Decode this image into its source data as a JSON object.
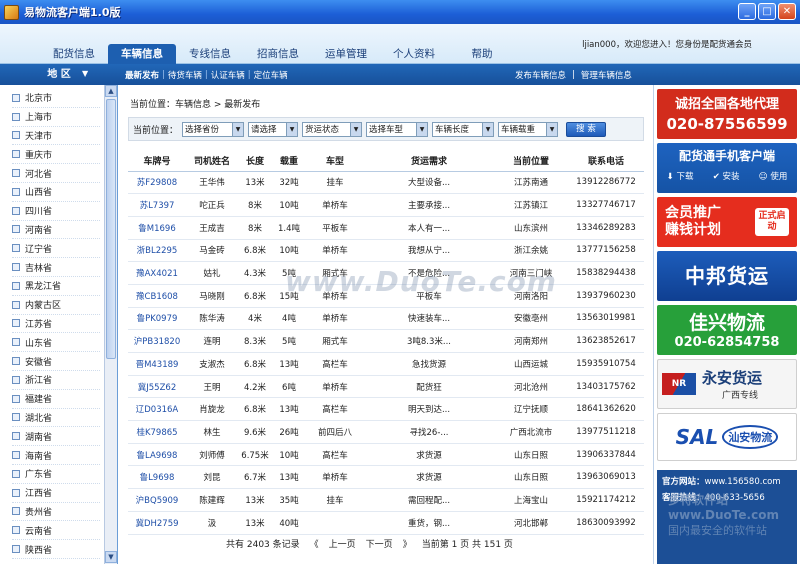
{
  "window": {
    "title": "易物流客户端1.0版",
    "min": "_",
    "max": "□",
    "close": "✕"
  },
  "header": {
    "tabs": [
      "配货信息",
      "车辆信息",
      "专线信息",
      "招商信息",
      "运单管理",
      "个人资料",
      "帮助"
    ],
    "active_tab": "车辆信息",
    "welcome": "ljian000，欢迎您进入！您身份是配货通会员"
  },
  "subnav": {
    "region_label": "地 区",
    "links": [
      "最新发布",
      "待货车辆",
      "认证车辆",
      "定位车辆"
    ],
    "right_links": [
      "发布车辆信息",
      "管理车辆信息"
    ]
  },
  "regions": [
    "北京市",
    "上海市",
    "天津市",
    "重庆市",
    "河北省",
    "山西省",
    "四川省",
    "河南省",
    "辽宁省",
    "吉林省",
    "黑龙江省",
    "内蒙古区",
    "江苏省",
    "山东省",
    "安徽省",
    "浙江省",
    "福建省",
    "湖北省",
    "湖南省",
    "海南省",
    "广东省",
    "江西省",
    "贵州省",
    "云南省",
    "陕西省"
  ],
  "breadcrumb": "当前位置：车辆信息 > 最新发布",
  "filters": {
    "label": "当前位置：",
    "selects": [
      "选择省份",
      "请选择",
      "货运状态",
      "选择车型",
      "车辆长度",
      "车辆载重"
    ],
    "search_btn": "搜 索"
  },
  "table": {
    "headers": [
      "车牌号",
      "司机姓名",
      "长度",
      "载重",
      "车型",
      "货运需求",
      "当前位置",
      "联系电话"
    ],
    "rows": [
      [
        "苏F29808",
        "王华伟",
        "13米",
        "32吨",
        "挂车",
        "大型设备...",
        "江苏南通",
        "13912286772"
      ],
      [
        "苏L7397",
        "咜正兵",
        "8米",
        "10吨",
        "单桥车",
        "主要承接...",
        "江苏镇江",
        "13327746717"
      ],
      [
        "鲁M1696",
        "王成吉",
        "8米",
        "1.4吨",
        "平板车",
        "本人有一...",
        "山东滨州",
        "13346289283"
      ],
      [
        "浙BL2295",
        "马金砖",
        "6.8米",
        "10吨",
        "单桥车",
        "我想从宁...",
        "浙江余姚",
        "13777156258"
      ],
      [
        "豫AX4021",
        "姑礼",
        "4.3米",
        "5吨",
        "厢式车",
        "不是危险...",
        "河南三门峡",
        "15838294438"
      ],
      [
        "豫CB1608",
        "马晓刚",
        "6.8米",
        "15吨",
        "单桥车",
        "平板车",
        "河南洛阳",
        "13937960230"
      ],
      [
        "鲁PK0979",
        "陈华涛",
        "4米",
        "4吨",
        "单桥车",
        "快速装车...",
        "安徽亳州",
        "13563019981"
      ],
      [
        "沪PB31820",
        "连明",
        "8.3米",
        "5吨",
        "厢式车",
        "3吨8.3米...",
        "河南郑州",
        "13623852617"
      ],
      [
        "晋M43189",
        "支淑杰",
        "6.8米",
        "13吨",
        "高栏车",
        "急找货源",
        "山西运城",
        "15935910754"
      ],
      [
        "冀J55Z62",
        "王明",
        "4.2米",
        "6吨",
        "单桥车",
        "配货狂",
        "河北沧州",
        "13403175762"
      ],
      [
        "辽D0316A",
        "肖旋龙",
        "6.8米",
        "13吨",
        "高栏车",
        "明天到达...",
        "辽宁抚顺",
        "18641362620"
      ],
      [
        "桂K79865",
        "林生",
        "9.6米",
        "26吨",
        "前四后八",
        "寻找26-...",
        "广西北流市",
        "13977511218"
      ],
      [
        "鲁LA9698",
        "刘师傅",
        "6.75米",
        "10吨",
        "高栏车",
        "求货源",
        "山东日照",
        "13906337844"
      ],
      [
        "鲁L9698",
        "刘昆",
        "6.7米",
        "13吨",
        "单桥车",
        "求货源",
        "山东日照",
        "13963069013"
      ],
      [
        "沪BQ5909",
        "陈建辉",
        "13米",
        "35吨",
        "挂车",
        "需回程配...",
        "上海宝山",
        "15921174212"
      ],
      [
        "冀DH2759",
        "汲",
        "13米",
        "40吨",
        "",
        "重货，钢...",
        "河北邯郸",
        "18630093992"
      ]
    ]
  },
  "pager": {
    "total": "共有 2403 条记录",
    "first": "《",
    "prev": "上一页",
    "next": "下一页",
    "last": "》",
    "current": "当前第 1 页 共 151 页"
  },
  "ads": {
    "ad1": [
      "诚招全国各地代理",
      "020-87556599"
    ],
    "ad2": {
      "title": "配货通手机客户端",
      "items": [
        "下载",
        "安装",
        "使用"
      ]
    },
    "ad3": {
      "text": [
        "会员推广",
        "赚钱计划"
      ],
      "tag": "正式启动"
    },
    "ad4": "中邦货运",
    "ad5": [
      "佳兴物流",
      "020-62854758"
    ],
    "ad6": {
      "logo": "NR",
      "name": "永安货运",
      "sub": "广西专线"
    },
    "ad7": {
      "brand": "SAL",
      "cn": "汕安物流"
    },
    "footer": {
      "site_label": "官方网站：",
      "site": "www.156580.com",
      "hotline_label": "客服热线：",
      "hotline": "400-633-5656"
    }
  },
  "watermark": {
    "center": "www.DuoTe.com",
    "br1": "多特软件站",
    "br2": "www.DuoTe.com",
    "br3": "国内最安全的软件站"
  }
}
